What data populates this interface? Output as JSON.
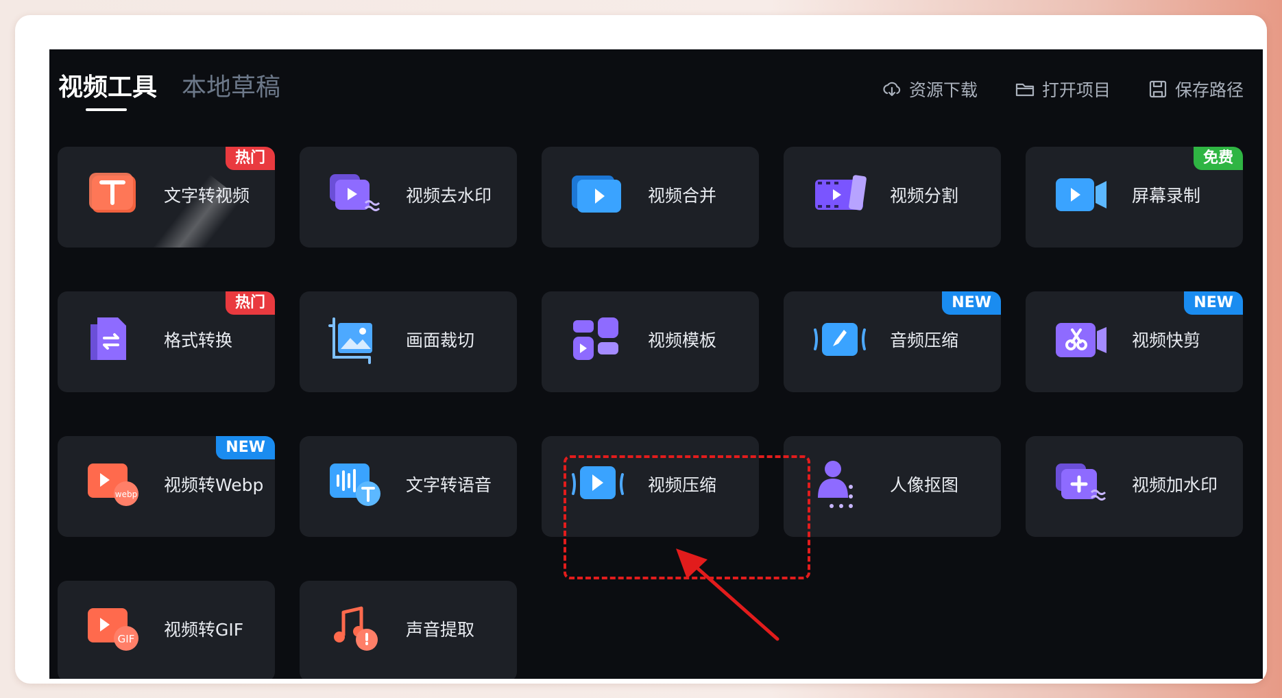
{
  "tabs": [
    {
      "label": "视频工具",
      "active": true
    },
    {
      "label": "本地草稿",
      "active": false
    }
  ],
  "actions": [
    {
      "label": "资源下载",
      "icon": "download-cloud-icon"
    },
    {
      "label": "打开项目",
      "icon": "folder-open-icon"
    },
    {
      "label": "保存路径",
      "icon": "save-disk-icon"
    }
  ],
  "tools": [
    {
      "label": "文字转视频",
      "badge": "热门",
      "badge_color": "red",
      "icon": "text-to-video-icon"
    },
    {
      "label": "视频去水印",
      "badge": "",
      "icon": "remove-watermark-icon"
    },
    {
      "label": "视频合并",
      "badge": "",
      "icon": "merge-video-icon"
    },
    {
      "label": "视频分割",
      "badge": "",
      "icon": "split-video-icon"
    },
    {
      "label": "屏幕录制",
      "badge": "免费",
      "badge_color": "green",
      "icon": "screen-record-icon"
    },
    {
      "label": "格式转换",
      "badge": "热门",
      "badge_color": "red",
      "icon": "format-convert-icon"
    },
    {
      "label": "画面裁切",
      "badge": "",
      "icon": "crop-image-icon"
    },
    {
      "label": "视频模板",
      "badge": "",
      "icon": "template-icon"
    },
    {
      "label": "音频压缩",
      "badge": "NEW",
      "badge_color": "blue",
      "icon": "audio-compress-icon"
    },
    {
      "label": "视频快剪",
      "badge": "NEW",
      "badge_color": "blue",
      "icon": "quick-cut-icon"
    },
    {
      "label": "视频转Webp",
      "badge": "NEW",
      "badge_color": "blue",
      "icon": "video-to-webp-icon"
    },
    {
      "label": "文字转语音",
      "badge": "",
      "icon": "text-to-speech-icon"
    },
    {
      "label": "视频压缩",
      "badge": "",
      "icon": "video-compress-icon"
    },
    {
      "label": "人像抠图",
      "badge": "",
      "icon": "portrait-cutout-icon"
    },
    {
      "label": "视频加水印",
      "badge": "",
      "icon": "add-watermark-icon"
    },
    {
      "label": "视频转GIF",
      "badge": "",
      "icon": "video-to-gif-icon"
    },
    {
      "label": "声音提取",
      "badge": "",
      "icon": "audio-extract-icon"
    }
  ],
  "colors": {
    "accent_red": "#e93a3f",
    "accent_blue": "#1a8cf0",
    "accent_green": "#2fb543",
    "annotation_red": "#e21c1c"
  }
}
